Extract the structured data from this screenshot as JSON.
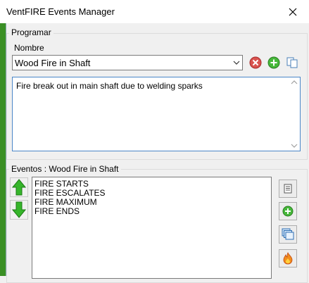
{
  "window": {
    "title": "VentFIRE Events Manager"
  },
  "programar": {
    "legend": "Programar",
    "nombre_label": "Nombre",
    "selected_name": "Wood Fire in Shaft",
    "description": "Fire break out in main shaft due to welding sparks"
  },
  "eventos": {
    "legend": "Eventos : Wood Fire in Shaft",
    "items": [
      "FIRE STARTS",
      "FIRE ESCALATES",
      "FIRE MAXIMUM",
      "FIRE ENDS"
    ]
  },
  "colors": {
    "accent_green": "#2f9d27",
    "delete_red": "#d9534f",
    "focus_blue": "#4a86c8"
  },
  "icons": {
    "close": "close-icon",
    "dropdown": "chevron-down-icon",
    "delete": "delete-icon",
    "add": "add-icon",
    "copy": "copy-icon",
    "move_up": "arrow-up-icon",
    "move_down": "arrow-down-icon",
    "properties": "properties-icon",
    "add_event": "add-icon",
    "duplicate": "duplicate-icon",
    "fire": "fire-icon"
  }
}
